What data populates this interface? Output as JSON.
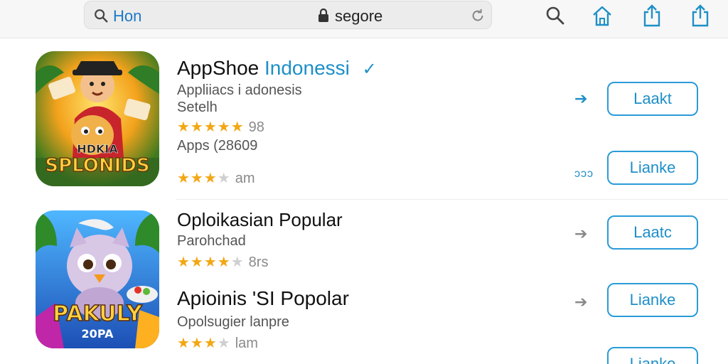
{
  "toolbar": {
    "search_query": "Hon",
    "url": "segore",
    "icons": [
      "search-icon",
      "home-icon",
      "share-icon",
      "share-icon-2"
    ]
  },
  "colors": {
    "accent": "#1e8fc7",
    "star": "#f2a714",
    "button_border": "#2a9bd8"
  },
  "apps": [
    {
      "title": "AppShoe",
      "title_accent": "Indonessi",
      "subtitle": "Appliiacs i adonesis",
      "subtitle2": "Setelh",
      "stars_rating": 5,
      "rating_text": "98",
      "extra_line": "Apps (28609",
      "stars2_rating": 3,
      "rating2_text": "am",
      "icon_lines": [
        "HDKIA",
        "SPLONIDS"
      ],
      "button_label": "Laakt",
      "button2_label": "Lianke",
      "arrow_label": "➔",
      "dots_label": "ɔɔɔ"
    },
    {
      "title": "Oploikasian Popular",
      "subtitle": "Parohchad",
      "stars_rating": 4,
      "rating_text": "8rs",
      "button_label": "Laatc",
      "arrow_label": "➔",
      "icon_lines": [
        "PAKULY",
        "20PA"
      ]
    },
    {
      "title": "Apioinis 'SI Popolar",
      "subtitle": "Opolsugier lanpre",
      "stars_rating": 3,
      "rating_text": "lam",
      "button_label": "Lianke",
      "arrow_label": "➔"
    },
    {
      "button_label": "Lianke"
    }
  ]
}
